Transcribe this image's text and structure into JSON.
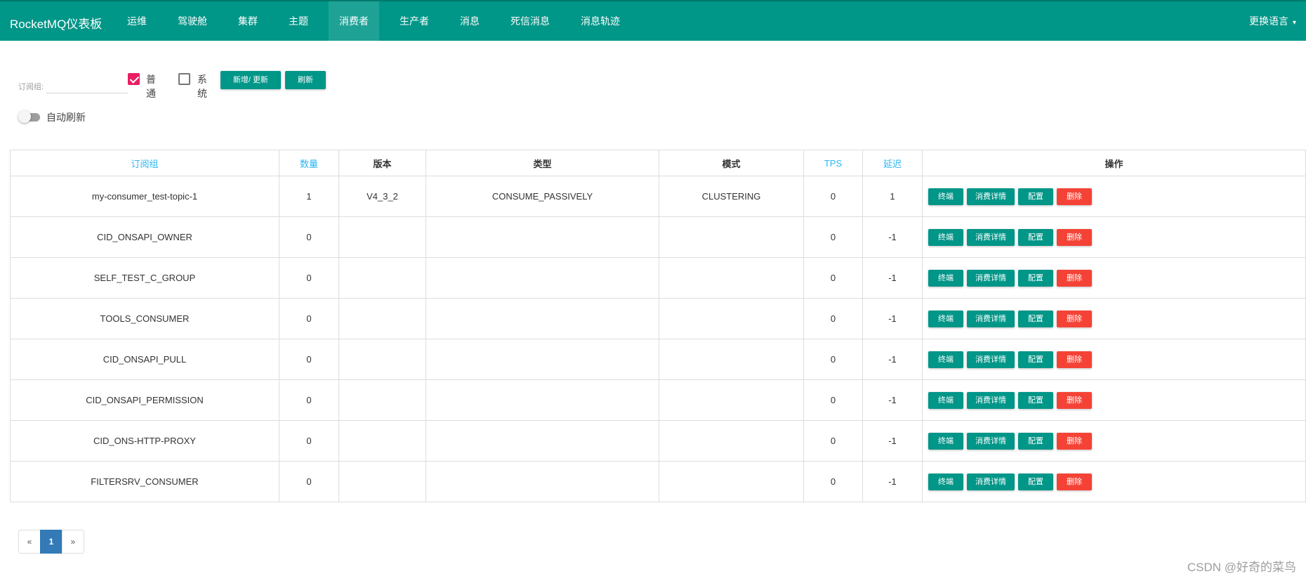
{
  "navbar": {
    "brand": "RocketMQ仪表板",
    "items": [
      "运维",
      "驾驶舱",
      "集群",
      "主题",
      "消费者",
      "生产者",
      "消息",
      "死信消息",
      "消息轨迹"
    ],
    "active_index": 4,
    "language": "更换语言",
    "color": "#009688"
  },
  "filter": {
    "subscription_label": "订阅组:",
    "subscription_value": "",
    "normal_label": "普通",
    "normal_checked": true,
    "system_label": "系统",
    "system_checked": false,
    "add_update_label": "新增/ 更新",
    "refresh_label": "刷新",
    "auto_refresh_label": "自动刷新",
    "auto_refresh_on": false
  },
  "table": {
    "headers": [
      "订阅组",
      "数量",
      "版本",
      "类型",
      "模式",
      "TPS",
      "延迟",
      "操作"
    ],
    "ops": [
      "终端",
      "消费详情",
      "配置",
      "删除"
    ],
    "rows": [
      [
        "my-consumer_test-topic-1",
        "1",
        "V4_3_2",
        "CONSUME_PASSIVELY",
        "CLUSTERING",
        "0",
        "1"
      ],
      [
        "CID_ONSAPI_OWNER",
        "0",
        "",
        "",
        "",
        "0",
        "-1"
      ],
      [
        "SELF_TEST_C_GROUP",
        "0",
        "",
        "",
        "",
        "0",
        "-1"
      ],
      [
        "TOOLS_CONSUMER",
        "0",
        "",
        "",
        "",
        "0",
        "-1"
      ],
      [
        "CID_ONSAPI_PULL",
        "0",
        "",
        "",
        "",
        "0",
        "-1"
      ],
      [
        "CID_ONSAPI_PERMISSION",
        "0",
        "",
        "",
        "",
        "0",
        "-1"
      ],
      [
        "CID_ONS-HTTP-PROXY",
        "0",
        "",
        "",
        "",
        "0",
        "-1"
      ],
      [
        "FILTERSRV_CONSUMER",
        "0",
        "",
        "",
        "",
        "0",
        "-1"
      ]
    ]
  },
  "pagination": {
    "prev": "«",
    "current": "1",
    "next": "»"
  },
  "watermark": "CSDN @好奇的菜鸟"
}
